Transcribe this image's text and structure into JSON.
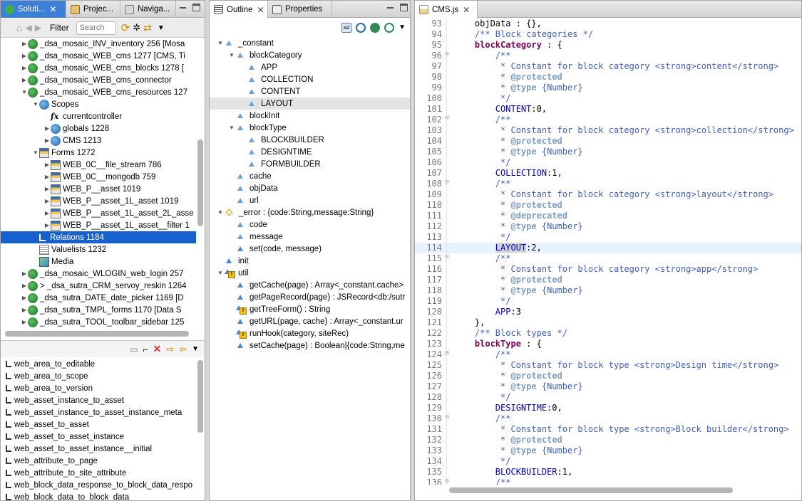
{
  "left_panel": {
    "tabs": [
      {
        "label": "Soluti...",
        "icon": "solution-icon"
      },
      {
        "label": "Projec...",
        "icon": "project-icon"
      },
      {
        "label": "Naviga...",
        "icon": "navigator-icon"
      }
    ],
    "toolbar": {
      "filter_label": "Filter",
      "search_placeholder": "Search"
    },
    "tree": [
      {
        "label": "_dsa_mosaic_INV_inventory 256 [Mosa",
        "depth": 1,
        "icon": "solution-globe-icon",
        "expand": "collapsed"
      },
      {
        "label": "_dsa_mosaic_WEB_cms 1277 [CMS, Ti",
        "depth": 1,
        "icon": "solution-globe-icon",
        "expand": "collapsed"
      },
      {
        "label": "_dsa_mosaic_WEB_cms_blocks 1278 [",
        "depth": 1,
        "icon": "solution-globe-icon",
        "expand": "collapsed"
      },
      {
        "label": "_dsa_mosaic_WEB_cms_connector",
        "depth": 1,
        "icon": "solution-globe-icon",
        "expand": "collapsed"
      },
      {
        "label": "_dsa_mosaic_WEB_cms_resources 127",
        "depth": 1,
        "icon": "solution-globe-icon",
        "expand": "expanded"
      },
      {
        "label": "Scopes",
        "depth": 2,
        "icon": "scopes-icon",
        "expand": "expanded"
      },
      {
        "label": "currentcontroller",
        "depth": 3,
        "icon": "function-icon",
        "expand": "none"
      },
      {
        "label": "globals 1228",
        "depth": 3,
        "icon": "scope-globe-icon",
        "expand": "collapsed"
      },
      {
        "label": "CMS 1213",
        "depth": 3,
        "icon": "scope-globe-icon",
        "expand": "collapsed"
      },
      {
        "label": "Forms 1272",
        "depth": 2,
        "icon": "forms-icon",
        "expand": "expanded"
      },
      {
        "label": "WEB_0C__file_stream 786",
        "depth": 3,
        "icon": "form-icon",
        "expand": "collapsed"
      },
      {
        "label": "WEB_0C__mongodb 759",
        "depth": 3,
        "icon": "form-icon",
        "expand": "collapsed"
      },
      {
        "label": "WEB_P__asset 1019",
        "depth": 3,
        "icon": "form-icon",
        "expand": "collapsed"
      },
      {
        "label": "WEB_P__asset_1L_asset 1019",
        "depth": 3,
        "icon": "form-icon",
        "expand": "collapsed"
      },
      {
        "label": "WEB_P__asset_1L_asset_2L_asse",
        "depth": 3,
        "icon": "form-icon",
        "expand": "collapsed"
      },
      {
        "label": "WEB_P__asset_1L_asset__filter 1",
        "depth": 3,
        "icon": "form-icon",
        "expand": "collapsed"
      },
      {
        "label": "Relations 1184",
        "depth": 2,
        "icon": "relations-icon",
        "expand": "none",
        "selected": true
      },
      {
        "label": "Valuelists 1232",
        "depth": 2,
        "icon": "valuelists-icon",
        "expand": "none"
      },
      {
        "label": "Media",
        "depth": 2,
        "icon": "media-icon",
        "expand": "none"
      },
      {
        "label": "_dsa_mosaic_WLOGIN_web_login 257",
        "depth": 1,
        "icon": "solution-globe-icon",
        "expand": "collapsed"
      },
      {
        "label": "> _dsa_sutra_CRM_servoy_reskin 1264",
        "depth": 1,
        "icon": "solution-globe-icon",
        "expand": "collapsed"
      },
      {
        "label": "_dsa_sutra_DATE_date_picker 1169 [D",
        "depth": 1,
        "icon": "solution-globe-icon",
        "expand": "collapsed"
      },
      {
        "label": "_dsa_sutra_TMPL_forms 1170 [Data S",
        "depth": 1,
        "icon": "solution-globe-icon",
        "expand": "collapsed"
      },
      {
        "label": "_dsa_sutra_TOOL_toolbar_sidebar 125",
        "depth": 1,
        "icon": "solution-globe-icon",
        "expand": "collapsed"
      }
    ],
    "relations": [
      "web_area_to_editable",
      "web_area_to_scope",
      "web_area_to_version",
      "web_asset_instance_to_asset",
      "web_asset_instance_to_asset_instance_meta",
      "web_asset_to_asset",
      "web_asset_to_asset_instance",
      "web_asset_to_asset_instance__initial",
      "web_attribute_to_page",
      "web_attribute_to_site_attribute",
      "web_block_data_response_to_block_data_respo",
      "web_block_data_to_block_data"
    ]
  },
  "outline": {
    "tabs": [
      {
        "label": "Outline",
        "icon": "outline-icon"
      },
      {
        "label": "Properties",
        "icon": "properties-icon"
      }
    ],
    "items": [
      {
        "label": "_constant",
        "depth": 0,
        "icon": "field-icon",
        "expand": "expanded"
      },
      {
        "label": "blockCategory",
        "depth": 1,
        "icon": "field-icon",
        "expand": "expanded"
      },
      {
        "label": "APP",
        "depth": 2,
        "icon": "field-icon",
        "expand": "none"
      },
      {
        "label": "COLLECTION",
        "depth": 2,
        "icon": "field-icon",
        "expand": "none"
      },
      {
        "label": "CONTENT",
        "depth": 2,
        "icon": "field-icon",
        "expand": "none"
      },
      {
        "label": "LAYOUT",
        "depth": 2,
        "icon": "field-icon",
        "expand": "none",
        "highlight": true
      },
      {
        "label": "blockInit",
        "depth": 1,
        "icon": "field-icon",
        "expand": "none"
      },
      {
        "label": "blockType",
        "depth": 1,
        "icon": "field-icon",
        "expand": "expanded"
      },
      {
        "label": "BLOCKBUILDER",
        "depth": 2,
        "icon": "field-icon",
        "expand": "none"
      },
      {
        "label": "DESIGNTIME",
        "depth": 2,
        "icon": "field-icon",
        "expand": "none"
      },
      {
        "label": "FORMBUILDER",
        "depth": 2,
        "icon": "field-icon",
        "expand": "none"
      },
      {
        "label": "cache",
        "depth": 1,
        "icon": "field-icon",
        "expand": "none"
      },
      {
        "label": "objData",
        "depth": 1,
        "icon": "field-icon",
        "expand": "none"
      },
      {
        "label": "url",
        "depth": 1,
        "icon": "field-icon",
        "expand": "none"
      },
      {
        "label": "_error : {code:String,message:String}",
        "depth": 0,
        "icon": "object-icon",
        "expand": "expanded"
      },
      {
        "label": "code",
        "depth": 1,
        "icon": "field-icon",
        "expand": "none"
      },
      {
        "label": "message",
        "depth": 1,
        "icon": "field-icon",
        "expand": "none"
      },
      {
        "label": "set(code, message)",
        "depth": 1,
        "icon": "method-icon",
        "expand": "none"
      },
      {
        "label": "init",
        "depth": 0,
        "icon": "method-icon",
        "expand": "none"
      },
      {
        "label": "util",
        "depth": 0,
        "icon": "warning-field-icon",
        "expand": "expanded"
      },
      {
        "label": "getCache(page) : Array<_constant.cache>",
        "depth": 1,
        "icon": "method-icon",
        "expand": "none"
      },
      {
        "label": "getPageRecord(page) : JSRecord<db:/sutr",
        "depth": 1,
        "icon": "method-icon",
        "expand": "none"
      },
      {
        "label": "getTreeForm() : String",
        "depth": 1,
        "icon": "warning-method-icon",
        "expand": "none"
      },
      {
        "label": "getURL(page, cache) : Array<_constant.ur",
        "depth": 1,
        "icon": "method-icon",
        "expand": "none"
      },
      {
        "label": "runHook(category, siteRec)",
        "depth": 1,
        "icon": "warning-method-icon",
        "expand": "none"
      },
      {
        "label": "setCache(page) : Boolean|{code:String,me",
        "depth": 1,
        "icon": "method-icon",
        "expand": "none"
      }
    ]
  },
  "editor": {
    "tab": {
      "label": "CMS.js",
      "icon": "js-file-icon"
    },
    "lines": [
      {
        "n": "93",
        "t": "    objData : {},",
        "cls": "plain"
      },
      {
        "n": "94",
        "t": "    /** Block categories */",
        "cls": "cm"
      },
      {
        "n": "95",
        "t": "    blockCategory : {",
        "cls": "field"
      },
      {
        "n": "96",
        "t": "        /**",
        "cls": "cm",
        "fold": true
      },
      {
        "n": "97",
        "t": "         * Constant for block category <strong>content</strong>",
        "cls": "cm"
      },
      {
        "n": "98",
        "t": "         * @protected",
        "cls": "cmtag"
      },
      {
        "n": "99",
        "t": "         * @type {Number}",
        "cls": "cmtag"
      },
      {
        "n": "100",
        "t": "         */",
        "cls": "cm"
      },
      {
        "n": "101",
        "t": "        CONTENT:0,",
        "cls": "const"
      },
      {
        "n": "102",
        "t": "        /**",
        "cls": "cm",
        "fold": true
      },
      {
        "n": "103",
        "t": "         * Constant for block category <strong>collection</strong>",
        "cls": "cm"
      },
      {
        "n": "104",
        "t": "         * @protected",
        "cls": "cmtag"
      },
      {
        "n": "105",
        "t": "         * @type {Number}",
        "cls": "cmtag"
      },
      {
        "n": "106",
        "t": "         */",
        "cls": "cm"
      },
      {
        "n": "107",
        "t": "        COLLECTION:1,",
        "cls": "const"
      },
      {
        "n": "108",
        "t": "        /**",
        "cls": "cm",
        "fold": true
      },
      {
        "n": "109",
        "t": "         * Constant for block category <strong>layout</strong>",
        "cls": "cm"
      },
      {
        "n": "110",
        "t": "         * @protected",
        "cls": "cmtag"
      },
      {
        "n": "111",
        "t": "         * @deprecated",
        "cls": "cmtag"
      },
      {
        "n": "112",
        "t": "         * @type {Number}",
        "cls": "cmtag"
      },
      {
        "n": "113",
        "t": "         */",
        "cls": "cm"
      },
      {
        "n": "114",
        "t": "        LAYOUT:2,",
        "cls": "const",
        "current": true
      },
      {
        "n": "115",
        "t": "        /**",
        "cls": "cm",
        "fold": true
      },
      {
        "n": "116",
        "t": "         * Constant for block category <strong>app</strong>",
        "cls": "cm"
      },
      {
        "n": "117",
        "t": "         * @protected",
        "cls": "cmtag"
      },
      {
        "n": "118",
        "t": "         * @type {Number}",
        "cls": "cmtag"
      },
      {
        "n": "119",
        "t": "         */",
        "cls": "cm"
      },
      {
        "n": "120",
        "t": "        APP:3",
        "cls": "const"
      },
      {
        "n": "121",
        "t": "    },",
        "cls": "plain"
      },
      {
        "n": "122",
        "t": "    /** Block types */",
        "cls": "cm"
      },
      {
        "n": "123",
        "t": "    blockType : {",
        "cls": "field"
      },
      {
        "n": "124",
        "t": "        /**",
        "cls": "cm",
        "fold": true
      },
      {
        "n": "125",
        "t": "         * Constant for block type <strong>Design time</strong>",
        "cls": "cm"
      },
      {
        "n": "126",
        "t": "         * @protected",
        "cls": "cmtag"
      },
      {
        "n": "127",
        "t": "         * @type {Number}",
        "cls": "cmtag"
      },
      {
        "n": "128",
        "t": "         */",
        "cls": "cm"
      },
      {
        "n": "129",
        "t": "        DESIGNTIME:0,",
        "cls": "const"
      },
      {
        "n": "130",
        "t": "        /**",
        "cls": "cm",
        "fold": true
      },
      {
        "n": "131",
        "t": "         * Constant for block type <strong>Block builder</strong>",
        "cls": "cm"
      },
      {
        "n": "132",
        "t": "         * @protected",
        "cls": "cmtag"
      },
      {
        "n": "133",
        "t": "         * @type {Number}",
        "cls": "cmtag"
      },
      {
        "n": "134",
        "t": "         */",
        "cls": "cm"
      },
      {
        "n": "135",
        "t": "        BLOCKBUILDER:1,",
        "cls": "const"
      },
      {
        "n": "136",
        "t": "        /**",
        "cls": "cm",
        "fold": true
      }
    ]
  }
}
